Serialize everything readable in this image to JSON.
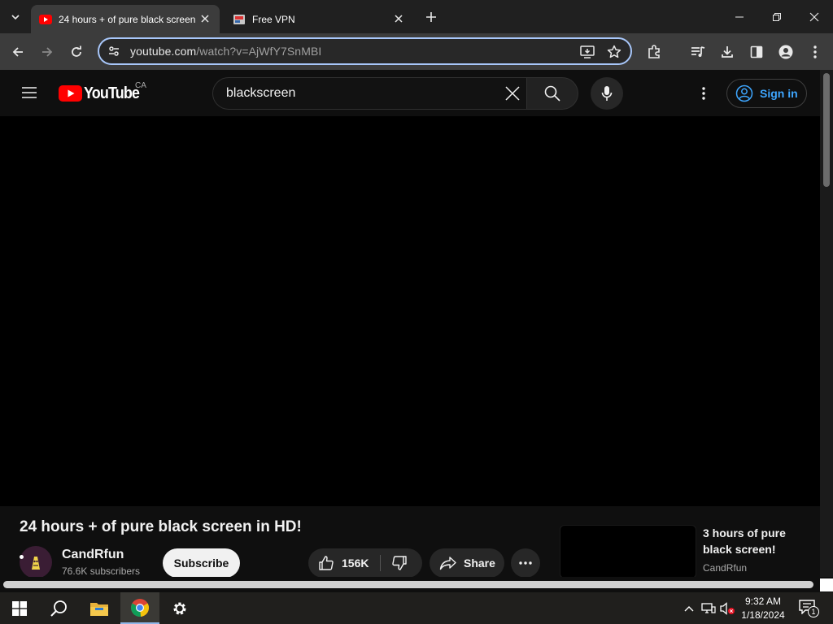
{
  "browser": {
    "tabs": [
      {
        "title": "24 hours + of pure black screen in HD!",
        "favicon": "youtube-favicon",
        "active": true
      },
      {
        "title": "Free VPN",
        "favicon": "vpn-favicon",
        "active": false
      }
    ],
    "address": {
      "domain": "youtube.com",
      "path": "/watch?v=AjWfY7SnMBI"
    }
  },
  "youtube": {
    "logo_text": "YouTube",
    "country": "CA",
    "search_query": "blackscreen",
    "sign_in": "Sign in",
    "video": {
      "title": "24 hours + of pure black screen in HD!",
      "channel": "CandRfun",
      "subscribers": "76.6K subscribers",
      "subscribe_label": "Subscribe",
      "likes": "156K",
      "share_label": "Share"
    },
    "suggested": {
      "title": "3 hours of pure black screen!",
      "channel": "CandRfun"
    }
  },
  "taskbar": {
    "time": "9:32 AM",
    "date": "1/18/2024",
    "notification_count": "1"
  },
  "colors": {
    "youtube_red": "#ff0000",
    "link_blue": "#3ea6ff",
    "omnibox_focus": "#a8c7fa"
  }
}
